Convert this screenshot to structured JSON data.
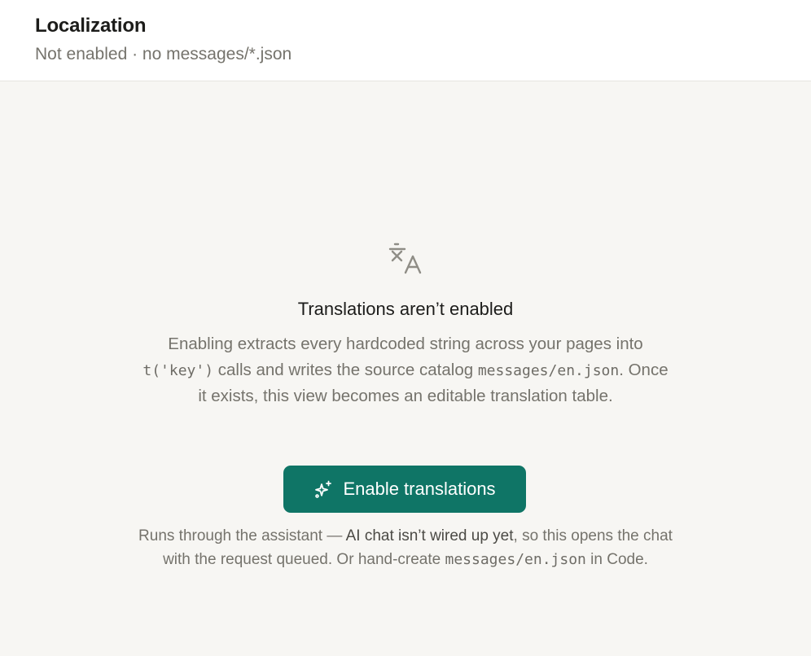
{
  "header": {
    "title": "Localization",
    "subtitle": "Not enabled · no messages/*.json"
  },
  "empty_state": {
    "icon": "translate-icon",
    "title": "Translations aren’t enabled",
    "description": {
      "part1": "Enabling extracts every hardcoded string across your pages into ",
      "code1": "t('key')",
      "part2": " calls and writes the source catalog ",
      "code2": "messages/en.json",
      "part3": ". Once it exists, this view becomes an editable translation table."
    },
    "button": {
      "label": "Enable translations",
      "icon": "sparkle-icon",
      "color": "#0f7566"
    },
    "footnote": {
      "part1": "Runs through the assistant — ",
      "highlight": "AI chat isn’t wired up yet",
      "part2": ", so this opens the chat with the request queued. Or hand-create ",
      "code": "messages/en.json",
      "part3": " in Code."
    }
  }
}
